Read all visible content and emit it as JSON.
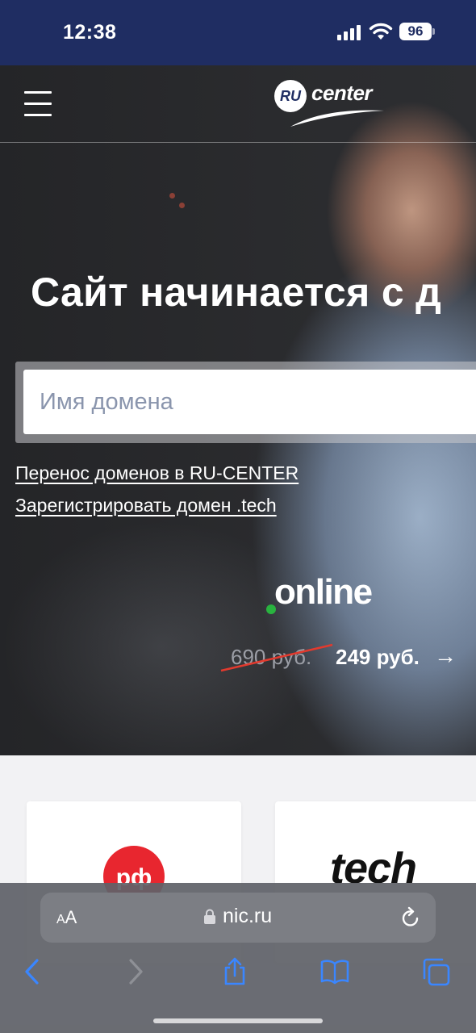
{
  "status_bar": {
    "time": "12:38",
    "battery": "96"
  },
  "header": {
    "logo_badge": "RU",
    "logo_text": "center",
    "menu_icon": "hamburger-icon"
  },
  "hero": {
    "title": "Сайт начинается с д",
    "search": {
      "placeholder": "Имя домена",
      "value": ""
    },
    "links": [
      "Перенос доменов в RU-CENTER",
      "Зарегистрировать домен .tech"
    ],
    "promo": {
      "zone": "online",
      "dot_color": "#29b33f",
      "old_price": "690 руб.",
      "new_price": "249 руб.",
      "arrow": "→"
    }
  },
  "cards": [
    {
      "logo_text": "рф",
      "logo_color": "#e8262f"
    },
    {
      "logo_text": "tech"
    }
  ],
  "safari": {
    "aa_label_small": "A",
    "aa_label_large": "A",
    "url": "nic.ru",
    "icons": [
      "back-icon",
      "forward-icon",
      "share-icon",
      "bookmarks-icon",
      "tabs-icon"
    ]
  },
  "colors": {
    "status_bar_bg": "#1f2d62",
    "accent_red": "#e8262f",
    "accent_green": "#29b33f",
    "link_blue": "#3a86ff"
  }
}
